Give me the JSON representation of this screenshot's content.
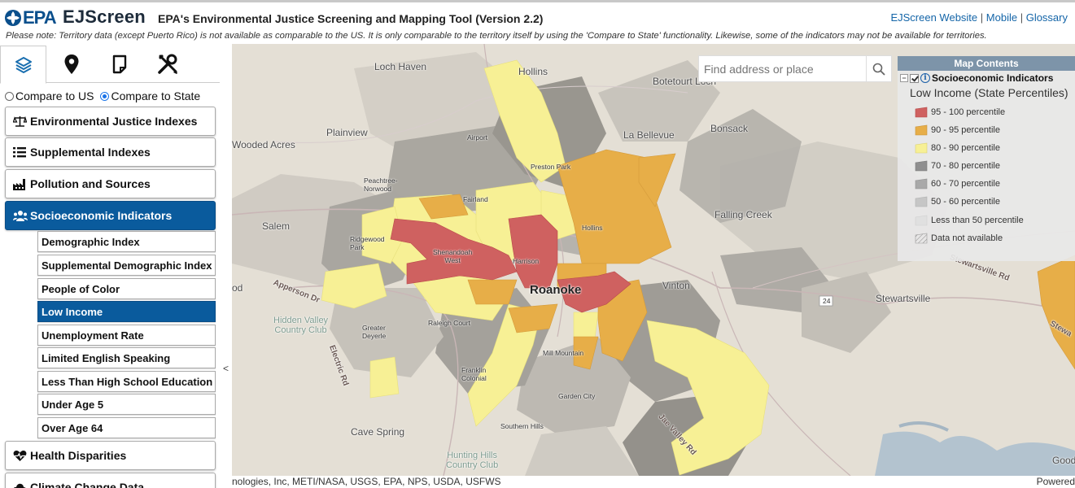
{
  "header": {
    "logo_text": "EPA",
    "app_name": "EJScreen",
    "subtitle": "EPA's Environmental Justice Screening and Mapping Tool (Version 2.2)",
    "links": [
      "EJScreen Website",
      "Mobile",
      "Glossary"
    ],
    "note": "Please note: Territory data (except Puerto Rico) is not available as comparable to the US. It is only comparable to the territory itself by using the 'Compare to State' functionality. Likewise, some of the indicators may not be available for territories."
  },
  "sidebar": {
    "tabs": [
      {
        "icon": "layers-icon",
        "active": true
      },
      {
        "icon": "map-pin-icon",
        "active": false
      },
      {
        "icon": "document-icon",
        "active": false
      },
      {
        "icon": "tools-icon",
        "active": false
      }
    ],
    "compare": {
      "us_label": "Compare to US",
      "state_label": "Compare to State",
      "selected": "state"
    },
    "menu": [
      {
        "label": "Environmental Justice Indexes",
        "icon": "scale-icon",
        "active": false
      },
      {
        "label": "Supplemental Indexes",
        "icon": "list-icon",
        "active": false
      },
      {
        "label": "Pollution and Sources",
        "icon": "factory-icon",
        "active": false
      },
      {
        "label": "Socioeconomic Indicators",
        "icon": "people-icon",
        "active": true
      }
    ],
    "submenu": [
      {
        "label": "Demographic Index",
        "active": false
      },
      {
        "label": "Supplemental Demographic Index",
        "active": false
      },
      {
        "label": "People of Color",
        "active": false
      },
      {
        "label": "Low Income",
        "active": true
      },
      {
        "label": "Unemployment Rate",
        "active": false
      },
      {
        "label": "Limited English Speaking",
        "active": false
      },
      {
        "label": "Less Than High School Education",
        "active": false
      },
      {
        "label": "Under Age 5",
        "active": false
      },
      {
        "label": "Over Age 64",
        "active": false
      }
    ],
    "menu_after": [
      {
        "label": "Health Disparities",
        "icon": "heart-pulse-icon"
      },
      {
        "label": "Climate Change Data",
        "icon": "cloud-icon"
      }
    ],
    "collapse_glyph": "<"
  },
  "search": {
    "placeholder": "Find address or place"
  },
  "legend": {
    "title": "Map Contents",
    "layer_name": "Socioeconomic Indicators",
    "subtitle": "Low Income (State Percentiles)",
    "items": [
      {
        "label": "95 - 100 percentile",
        "color": "#cf6160"
      },
      {
        "label": "90 - 95 percentile",
        "color": "#e7ae48"
      },
      {
        "label": "80 - 90 percentile",
        "color": "#f7f095"
      },
      {
        "label": "70 - 80 percentile",
        "color": "#8f8f8f"
      },
      {
        "label": "60 - 70 percentile",
        "color": "#a9a9a9"
      },
      {
        "label": "50 - 60 percentile",
        "color": "#c6c6c6"
      },
      {
        "label": "Less than 50 percentile",
        "color": "#e0e0e0"
      },
      {
        "label": "Data not available",
        "color": "hatch"
      }
    ]
  },
  "map_labels": {
    "loch_haven": "Loch Haven",
    "hollins_n": "Hollins",
    "botetourt": "Botetourt Loch",
    "plainview": "Plainview",
    "woodacres": "Wooded Acres",
    "airport": "Airport",
    "labellevue": "La Bellevue",
    "bonsack": "Bonsack",
    "preston": "Preston Park",
    "peachtree": "Peachtree-\nNorwood",
    "fairland": "Fairland",
    "hollins": "Hollins",
    "fallingcreek": "Falling Creek",
    "salem": "Salem",
    "ridgewood": "Ridgewood\nPark",
    "shenandoah": "Shenandoah\nWest",
    "harrison": "Harrison",
    "stewartsville_rd": "Stewartsville Rd",
    "roanoke": "Roanoke",
    "vinton": "Vinton",
    "od": "od",
    "appersonrd": "Apperson Dr",
    "stewartsville": "Stewartsville",
    "route24": "24",
    "hiddenvalley": "Hidden Valley\nCountry Club",
    "raleighcourt": "Raleigh Court",
    "greater_deyerle": "Greater\nDeyerle",
    "mill_mountain": "Mill Mountain",
    "electric_rd": "Electric Rd",
    "franklin": "Franklin\nColonial",
    "gardencity": "Garden City",
    "southernhills": "Southern Hills",
    "cavespring": "Cave Spring",
    "jaevalley": "Jae Valley Rd",
    "huntinghills": "Hunting Hills\nCountry Club",
    "goodview": "Goodvi",
    "stewartsville_r": "Stewa"
  },
  "attribution": {
    "left": "nologies, Inc, METI/NASA, USGS, EPA, NPS, USDA, USFWS",
    "right": "Powered"
  }
}
